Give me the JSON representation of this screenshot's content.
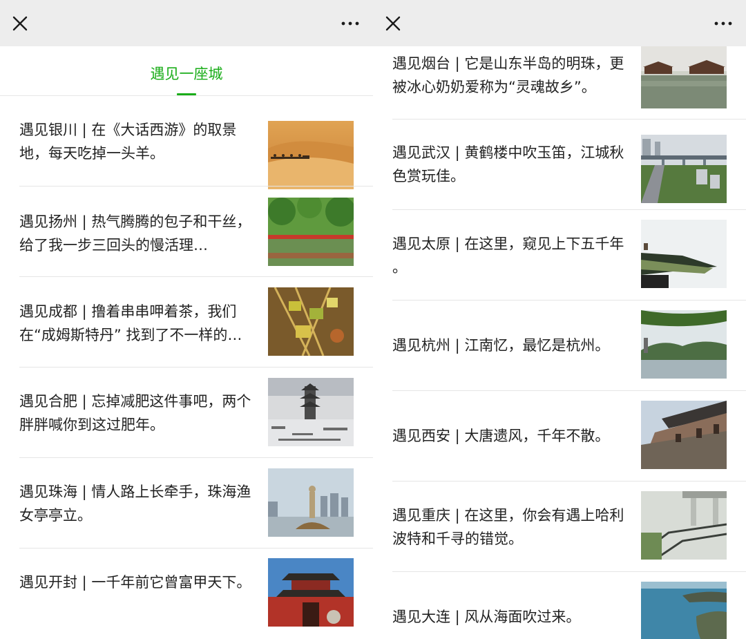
{
  "left": {
    "tab_title": "遇见一座城",
    "articles": [
      {
        "title": "遇见银川 | 在《大话西游》的取景地，每天吃掉一头羊。",
        "image": "desert-camels"
      },
      {
        "title": "遇见扬州 | 热气腾腾的包子和干丝，给了我一步三回头的慢活理…",
        "image": "green-park-red-bridge"
      },
      {
        "title": "遇见成都 | 撸着串串呷着茶，我们在“成姆斯特丹” 找到了不一样的…",
        "image": "skewers-food"
      },
      {
        "title": "遇见合肥 | 忘掉减肥这件事吧，两个胖胖喊你到这过肥年。",
        "image": "snowy-pagoda"
      },
      {
        "title": "遇见珠海 | 情人路上长牵手，珠海渔女亭亭立。",
        "image": "fisher-girl-statue"
      },
      {
        "title": "遇见开封 | 一千年前它曾富甲天下。",
        "image": "red-gate-tower"
      }
    ]
  },
  "right": {
    "articles": [
      {
        "title": "遇见烟台 | 它是山东半岛的明珠，更被冰心奶奶爱称为“灵魂故乡”。",
        "image": "lake-pavilions"
      },
      {
        "title": "遇见武汉 | 黄鹤楼中吹玉笛，江城秋色赏玩佳。",
        "image": "city-bridge"
      },
      {
        "title": "遇见太原 | 在这里，窥见上下五千年 。",
        "image": "temple-roof"
      },
      {
        "title": "遇见杭州 | 江南忆，最忆是杭州。",
        "image": "west-lake"
      },
      {
        "title": "遇见西安 | 大唐遗风，千年不散。",
        "image": "city-wall"
      },
      {
        "title": "遇见重庆 | 在这里，你会有遇上哈利波特和千寻的错觉。",
        "image": "overpass-stairs"
      },
      {
        "title": "遇见大连 | 风从海面吹过来。",
        "image": "sea-coast"
      }
    ]
  },
  "icons": {
    "close": "close-icon",
    "more": "more-icon"
  },
  "colors": {
    "accent": "#1aad19",
    "topbar": "#ededed",
    "text": "#222222"
  }
}
